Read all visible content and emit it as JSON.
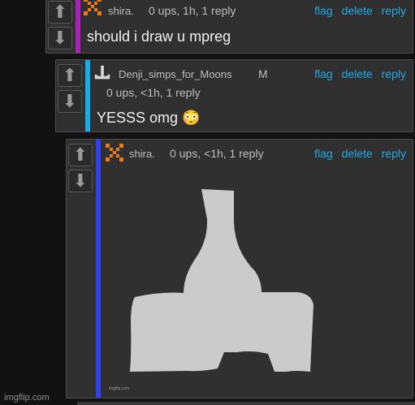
{
  "comments": [
    {
      "username": "shira.",
      "meta": "0 ups, 1h, 1 reply",
      "actions": [
        "flag",
        "delete",
        "reply"
      ],
      "text": "should i draw u mpreg",
      "accent": "#b01cc0"
    },
    {
      "username": "Denji_simps_for_Moons",
      "badge": "M",
      "meta": "0 ups, <1h, 1 reply",
      "actions": [
        "flag",
        "delete",
        "reply"
      ],
      "text": "YESSS omg 😳",
      "accent": "#16aeea"
    },
    {
      "username": "shira.",
      "meta": "0 ups, <1h, 1 reply",
      "actions": [
        "flag",
        "delete",
        "reply"
      ],
      "image_watermark": "imgflip.com",
      "accent": "#3541e8"
    }
  ],
  "vote_icons": {
    "up": "arrow-up-icon",
    "down": "arrow-down-icon"
  },
  "footer": {
    "watermark": "imgflip.com"
  }
}
